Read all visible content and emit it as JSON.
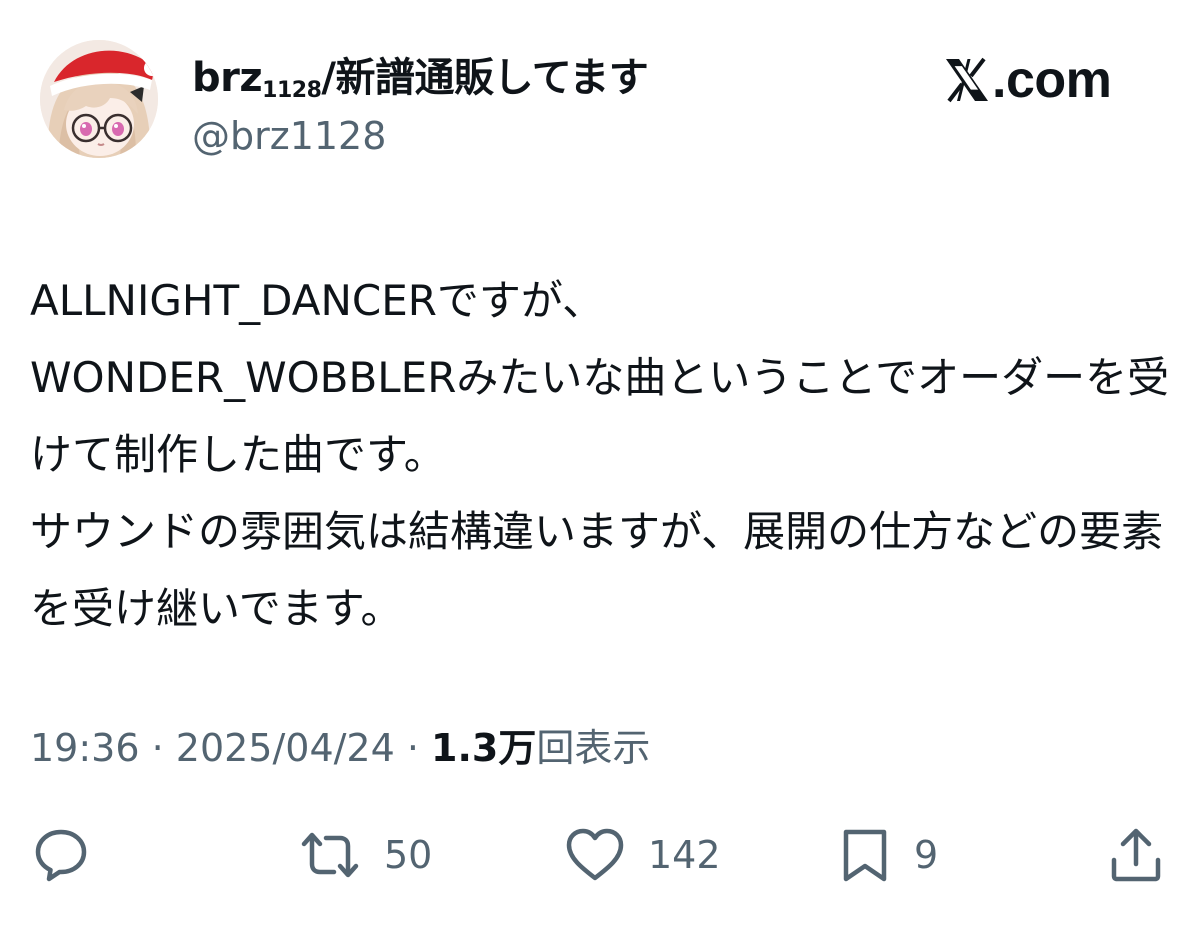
{
  "author": {
    "name_main": "brz",
    "name_sub": "1128",
    "name_rest": "/新譜通販してます",
    "handle": "@brz1128"
  },
  "brand": {
    "text": ".com",
    "icon": "x-logo-icon"
  },
  "tweet": {
    "text": "ALLNIGHT_DANCERですが、\nWONDER_WOBBLERみたいな曲ということでオーダーを受けて制作した曲です。\nサウンドの雰囲気は結構違いますが、展開の仕方などの要素を受け継いでます。"
  },
  "meta": {
    "time": "19:36",
    "separator": " · ",
    "date": "2025/04/24",
    "views": "1.3万",
    "views_label": "回表示"
  },
  "actions": {
    "reply": {
      "icon": "reply-icon",
      "count": ""
    },
    "repost": {
      "icon": "repost-icon",
      "count": "50"
    },
    "like": {
      "icon": "heart-icon",
      "count": "142"
    },
    "bookmark": {
      "icon": "bookmark-icon",
      "count": "9"
    },
    "share": {
      "icon": "share-icon",
      "count": ""
    }
  },
  "colors": {
    "text_primary": "#0f1419",
    "text_secondary": "#536471",
    "background": "#ffffff"
  }
}
